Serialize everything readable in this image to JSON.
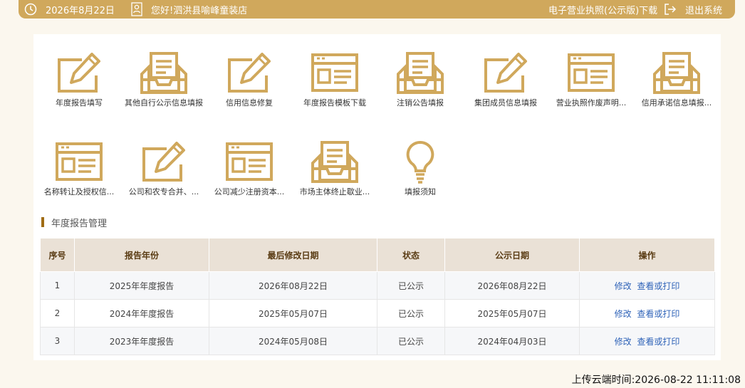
{
  "header": {
    "date": "2026年8月22日",
    "greeting": "您好!泗洪县喻峰童装店",
    "license_download": "电子营业执照(公示版)下载",
    "logout": "退出系统"
  },
  "icons": [
    {
      "label": "年度报告填写",
      "icon": "pencil-doc-icon"
    },
    {
      "label": "其他自行公示信息填报",
      "icon": "inbox-doc-icon"
    },
    {
      "label": "信用信息修复",
      "icon": "pencil-doc-icon"
    },
    {
      "label": "年度报告模板下载",
      "icon": "form-doc-icon"
    },
    {
      "label": "注销公告填报",
      "icon": "inbox-doc-icon"
    },
    {
      "label": "集团成员信息填报",
      "icon": "pencil-doc-icon"
    },
    {
      "label": "营业执照作废声明...",
      "icon": "form-doc-icon"
    },
    {
      "label": "信用承诺信息填报...",
      "icon": "inbox-doc-icon"
    },
    {
      "label": "名称转让及授权信...",
      "icon": "form-doc-icon"
    },
    {
      "label": "公司和农专合并、...",
      "icon": "pencil-doc-icon"
    },
    {
      "label": "公司减少注册资本...",
      "icon": "form-doc-icon"
    },
    {
      "label": "市场主体终止歇业...",
      "icon": "inbox-doc-icon"
    },
    {
      "label": "填报须知",
      "icon": "lightbulb-icon"
    }
  ],
  "section": {
    "title": "年度报告管理"
  },
  "table": {
    "headers": [
      "序号",
      "报告年份",
      "最后修改日期",
      "状态",
      "公示日期",
      "操作"
    ],
    "rows": [
      {
        "no": "1",
        "year": "2025年年度报告",
        "modified": "2026年08月22日",
        "status": "已公示",
        "published": "2026年08月22日",
        "edit": "修改",
        "view": "查看或打印"
      },
      {
        "no": "2",
        "year": "2024年年度报告",
        "modified": "2025年05月07日",
        "status": "已公示",
        "published": "2025年05月07日",
        "edit": "修改",
        "view": "查看或打印"
      },
      {
        "no": "3",
        "year": "2023年年度报告",
        "modified": "2024年05月08日",
        "status": "已公示",
        "published": "2024年04月03日",
        "edit": "修改",
        "view": "查看或打印"
      }
    ]
  },
  "footer": {
    "upload_time": "上传云端时间:2026-08-22 11:11:08"
  },
  "colors": {
    "gold": "#d0a85c",
    "link": "#2f63b8",
    "header_bg": "#eae1d6"
  }
}
